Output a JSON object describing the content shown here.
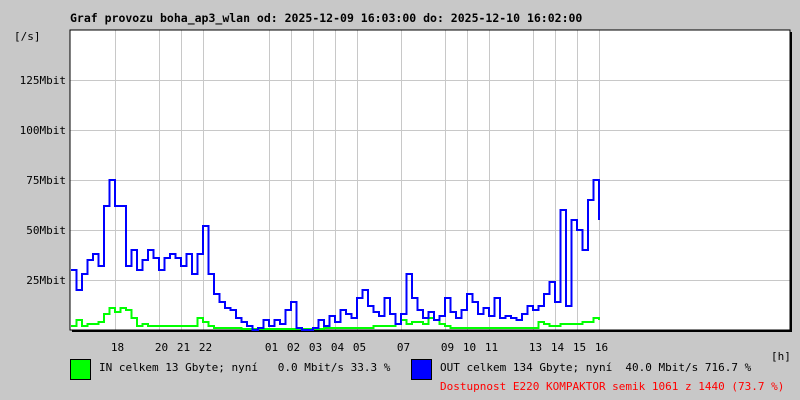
{
  "chart_data": {
    "type": "line",
    "title": "Graf provozu boha_ap3_wlan od: 2025-12-09 16:03:00 do: 2025-12-10 16:02:00",
    "ylabel": "[/s]",
    "xlabel": "[h]",
    "ylim": [
      0,
      150
    ],
    "y_unit": "Mbit",
    "yticks": [
      {
        "v": 25,
        "label": "25Mbit"
      },
      {
        "v": 50,
        "label": "50Mbit"
      },
      {
        "v": 75,
        "label": "75Mbit"
      },
      {
        "v": 100,
        "label": "100Mbit"
      },
      {
        "v": 125,
        "label": "125Mbit"
      }
    ],
    "xticks": [
      {
        "h": 2,
        "label": "18"
      },
      {
        "h": 4,
        "label": "20"
      },
      {
        "h": 5,
        "label": "21"
      },
      {
        "h": 6,
        "label": "22"
      },
      {
        "h": 9,
        "label": "01"
      },
      {
        "h": 10,
        "label": "02"
      },
      {
        "h": 11,
        "label": "03"
      },
      {
        "h": 12,
        "label": "04"
      },
      {
        "h": 13,
        "label": "05"
      },
      {
        "h": 15,
        "label": "07"
      },
      {
        "h": 17,
        "label": "09"
      },
      {
        "h": 18,
        "label": "10"
      },
      {
        "h": 19,
        "label": "11"
      },
      {
        "h": 21,
        "label": "13"
      },
      {
        "h": 22,
        "label": "14"
      },
      {
        "h": 23,
        "label": "15"
      },
      {
        "h": 24,
        "label": "16"
      }
    ],
    "x_hours_since": "16:00",
    "x_step_hours": 0.25,
    "x_range_hours": [
      0,
      32.7
    ],
    "grid": true,
    "series": [
      {
        "name": "OUT",
        "color": "#0000ff",
        "values": [
          30,
          20,
          28,
          35,
          38,
          32,
          62,
          75,
          62,
          62,
          32,
          40,
          30,
          35,
          40,
          36,
          30,
          36,
          38,
          36,
          32,
          38,
          28,
          38,
          52,
          28,
          18,
          14,
          11,
          10,
          6,
          4,
          2,
          0,
          1,
          5,
          2,
          5,
          3,
          10,
          14,
          1,
          0,
          0,
          1,
          5,
          2,
          7,
          4,
          10,
          8,
          6,
          16,
          20,
          12,
          9,
          7,
          16,
          8,
          3,
          8,
          28,
          16,
          10,
          6,
          9,
          5,
          7,
          16,
          9,
          6,
          10,
          18,
          14,
          8,
          11,
          7,
          16,
          6,
          7,
          6,
          5,
          8,
          12,
          10,
          12,
          18,
          24,
          14,
          60,
          12,
          55,
          50,
          40,
          65,
          75,
          55
        ]
      },
      {
        "name": "IN",
        "color": "#00ff00",
        "values": [
          2,
          5,
          2,
          3,
          3,
          4,
          8,
          11,
          9,
          11,
          10,
          6,
          2,
          3,
          2,
          2,
          2,
          2,
          2,
          2,
          2,
          2,
          2,
          6,
          4,
          2,
          1,
          1,
          1,
          1,
          1,
          0.5,
          0.5,
          0.5,
          0.5,
          0.5,
          0.5,
          0.5,
          0.5,
          0.5,
          0.5,
          0.5,
          0.5,
          0.5,
          0.5,
          0.5,
          1,
          1,
          1,
          1,
          1,
          1,
          1,
          1,
          1,
          2,
          2,
          2,
          2,
          3,
          5,
          3,
          4,
          4,
          3,
          6,
          5,
          3,
          2,
          1,
          1,
          1,
          1,
          1,
          1,
          1,
          1,
          1,
          1,
          1,
          1,
          1,
          1,
          1,
          1,
          4,
          3,
          2,
          2,
          3,
          3,
          3,
          3,
          4,
          4,
          6,
          5
        ]
      }
    ]
  },
  "legend": {
    "in_text": "IN celkem 13 Gbyte; nyní   0.0 Mbit/s 33.3 %",
    "out_text": "OUT celkem 134 Gbyte; nyní  40.0 Mbit/s 716.7 %",
    "availability": "Dostupnost E220 KOMPAKTOR semik 1061 z 1440 (73.7 %)",
    "availability_color": "#ff0000"
  }
}
